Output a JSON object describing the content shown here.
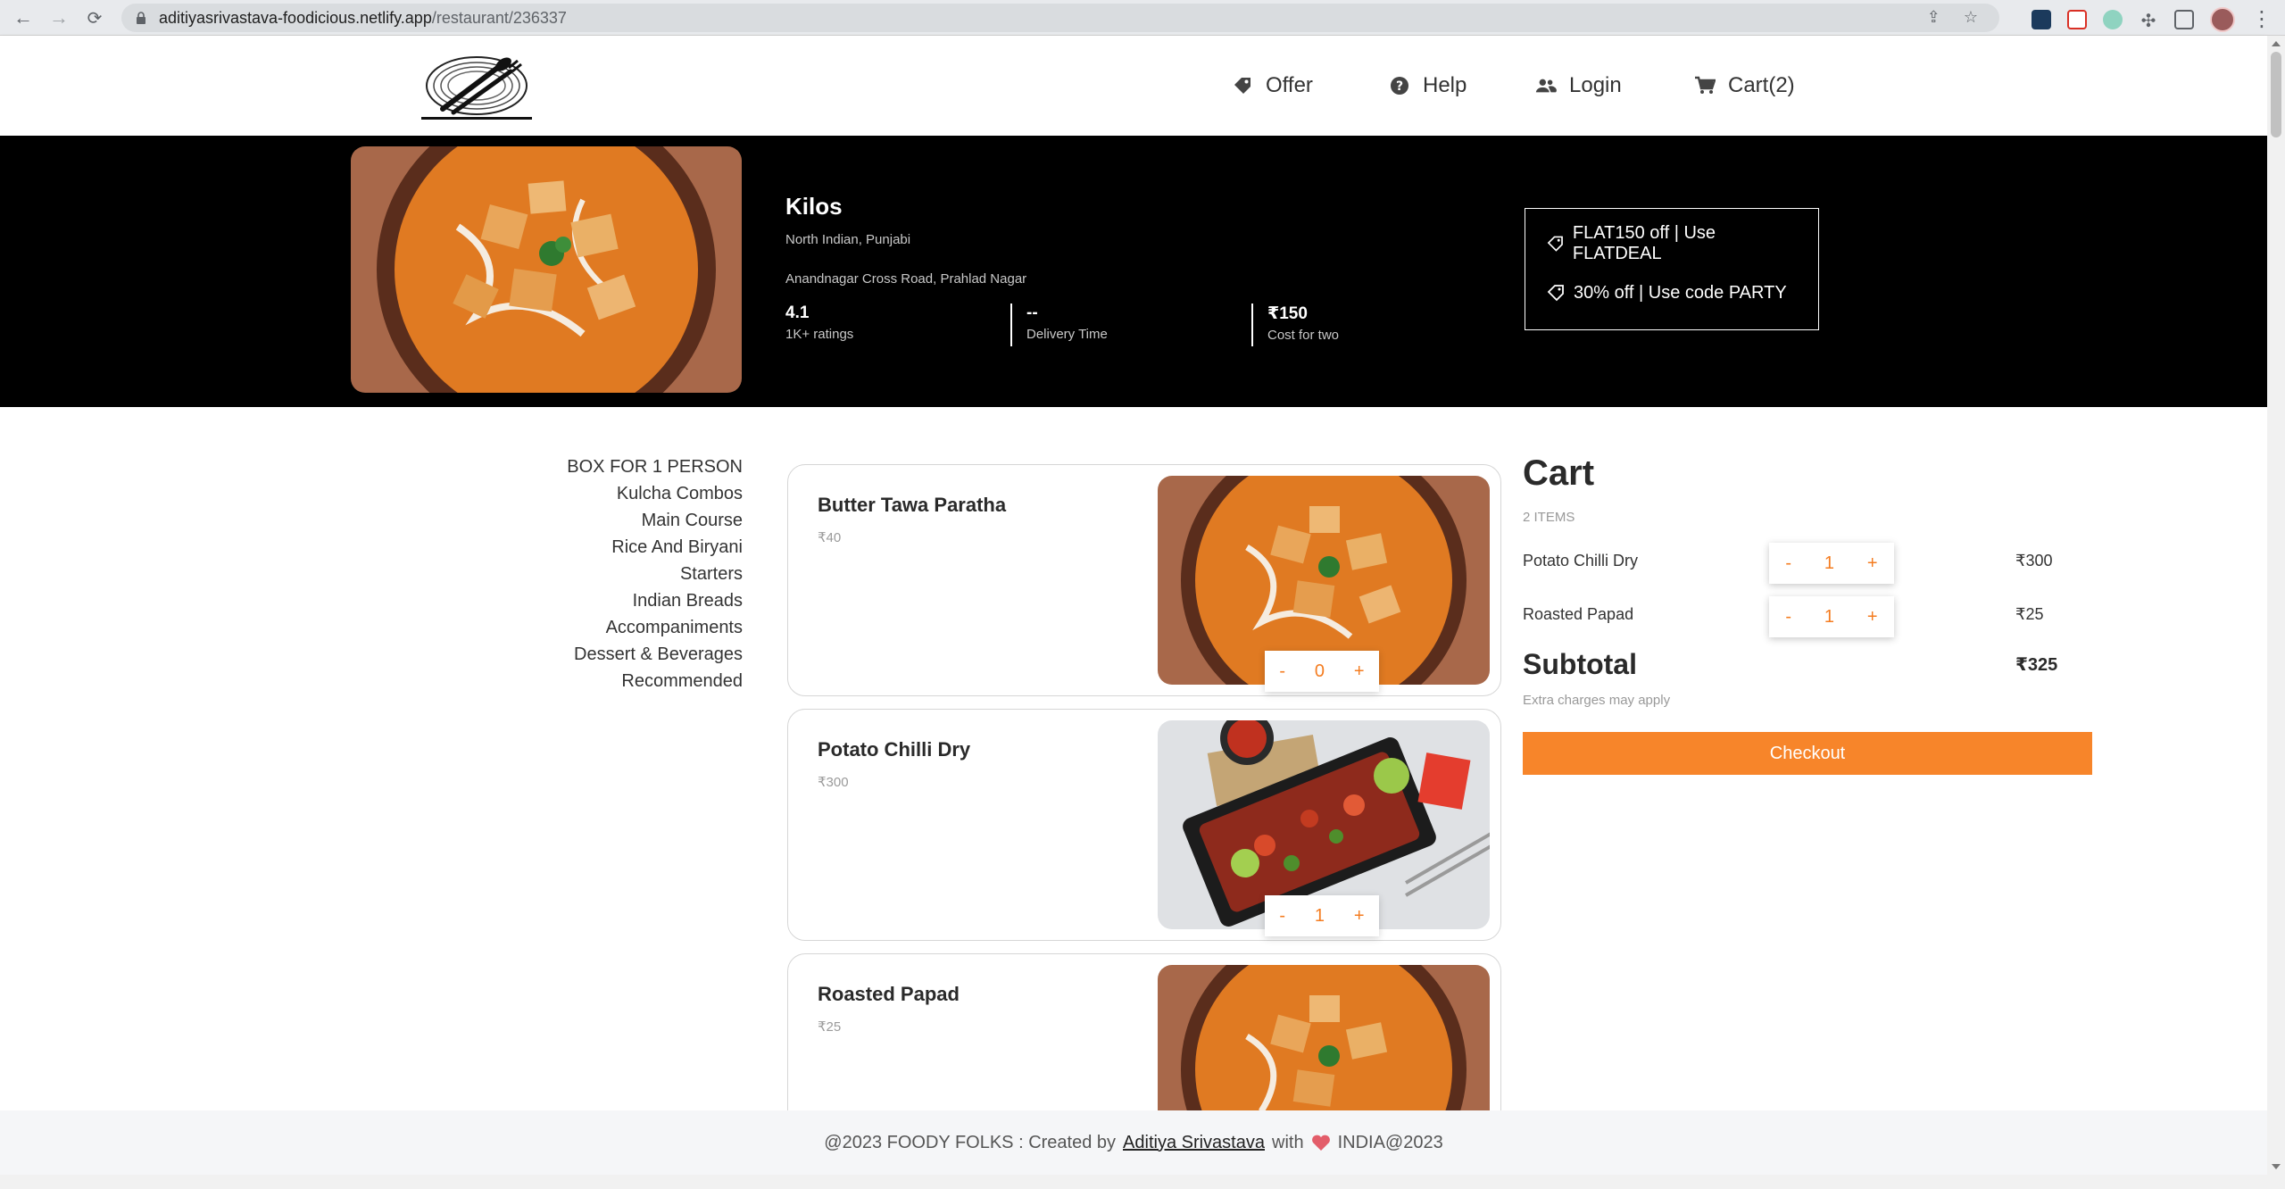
{
  "browser": {
    "url_host": "aditiyasrivastava-foodicious.netlify.app",
    "url_path": "/restaurant/236337"
  },
  "nav": {
    "offer": "Offer",
    "help": "Help",
    "login": "Login",
    "cart": "Cart(2)"
  },
  "restaurant": {
    "name": "Kilos",
    "cuisine": "North Indian, Punjabi",
    "address": "Anandnagar Cross Road, Prahlad Nagar",
    "stats": [
      {
        "value": "4.1",
        "label": "1K+ ratings"
      },
      {
        "value": "--",
        "label": "Delivery Time"
      },
      {
        "value": "₹150",
        "label": "Cost for two"
      }
    ],
    "offers": [
      "FLAT150 off | Use FLATDEAL",
      "30% off | Use code PARTY"
    ]
  },
  "categories": [
    "BOX FOR 1 PERSON",
    "Kulcha Combos",
    "Main Course",
    "Rice And Biryani",
    "Starters",
    "Indian Breads",
    "Accompaniments",
    "Dessert & Beverages",
    "Recommended"
  ],
  "menu": [
    {
      "name": "Butter Tawa Paratha",
      "price": "₹40",
      "qty": "0",
      "minus": "-",
      "plus": "+"
    },
    {
      "name": "Potato Chilli Dry",
      "price": "₹300",
      "qty": "1",
      "minus": "-",
      "plus": "+"
    },
    {
      "name": "Roasted Papad",
      "price": "₹25",
      "qty": "",
      "minus": "",
      "plus": ""
    }
  ],
  "cart": {
    "title": "Cart",
    "count": "2 ITEMS",
    "items": [
      {
        "name": "Potato Chilli Dry",
        "qty": "1",
        "price": "₹300",
        "minus": "-",
        "plus": "+"
      },
      {
        "name": "Roasted Papad",
        "qty": "1",
        "price": "₹25",
        "minus": "-",
        "plus": "+"
      }
    ],
    "subtotal_label": "Subtotal",
    "subtotal_value": "₹325",
    "extra_note": "Extra charges may apply",
    "checkout_label": "Checkout"
  },
  "footer": {
    "prefix": "@2023 FOODY FOLKS : Created by",
    "author": "Aditiya Srivastava",
    "with": "with",
    "suffix": "INDIA@2023"
  },
  "colors": {
    "accent": "#f7852a",
    "banner_bg": "#000000",
    "heart": "#e35d6a"
  }
}
